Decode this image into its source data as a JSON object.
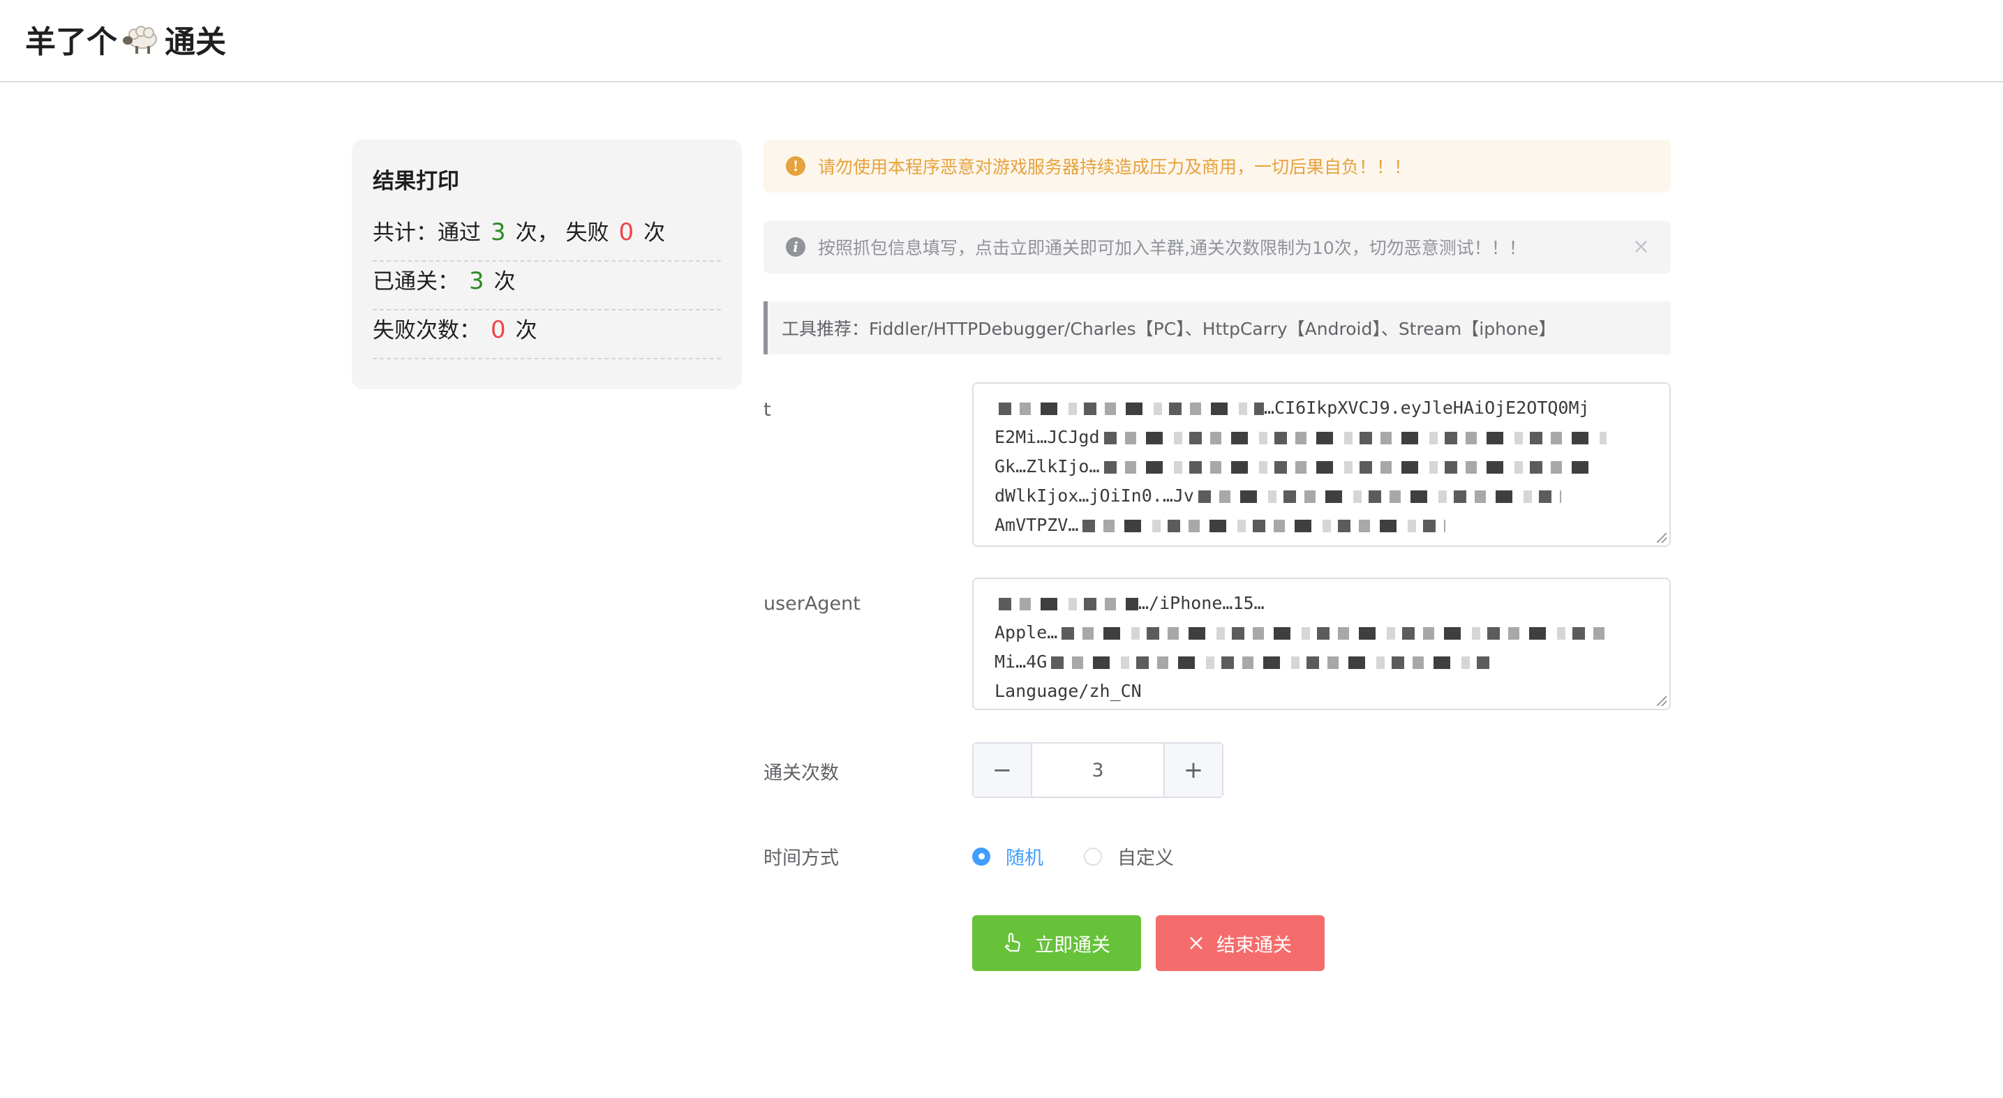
{
  "app": {
    "title_prefix": "羊了个",
    "title_suffix": "通关",
    "title_icon": "sheep-icon"
  },
  "result": {
    "title": "结果打印",
    "summary_prefix": "共计：通过",
    "passed": "3",
    "summary_mid": "次，  失败",
    "failed": "0",
    "unit": "次",
    "passed_label": "已通关：",
    "failed_label": "失败次数："
  },
  "alerts": {
    "warning": "请勿使用本程序恶意对游戏服务器持续造成压力及商用，一切后果自负！！！",
    "info": "按照抓包信息填写，点击立即通关即可加入羊群,通关次数限制为10次，切勿恶意测试！！！",
    "tools": "工具推荐：Fiddler/HTTPDebugger/Charles【PC】、HttpCarry【Android】、Stream【iphone】"
  },
  "form": {
    "token_label": "t",
    "token_lines": [
      "…CI6IkpXVCJ9.eyJleHAiOjE2OTQ0Mj",
      "E2Mi…JCJgd",
      "Gk…ZlkIjo…",
      "dWlkIjox…jOiIn0.…Jv",
      "AmVTPZV…"
    ],
    "ua_label": "userAgent",
    "ua_lines": [
      "…/iPhone…15…",
      "Apple…",
      "Mi…4G",
      "Language/zh_CN"
    ],
    "count_label": "通关次数",
    "count_value": "3",
    "time_label": "时间方式",
    "time_options": [
      "随机",
      "自定义"
    ],
    "time_selected": "随机"
  },
  "buttons": {
    "start": "立即通关",
    "stop": "结束通关"
  },
  "colors": {
    "success": "#67c23a",
    "danger": "#f56c6c",
    "primary": "#409eff",
    "warning": "#e6a23c",
    "passed": "#2e8b23",
    "failed": "#f0434b"
  }
}
